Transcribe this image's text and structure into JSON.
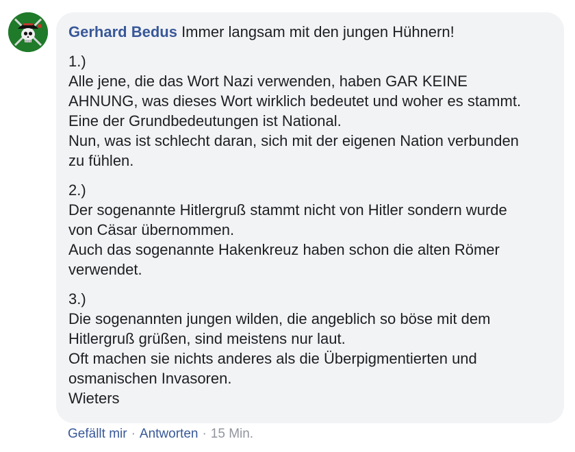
{
  "comment": {
    "author": "Gerhard Bedus",
    "intro": "Immer langsam mit den jungen Hühnern!",
    "paragraphs": [
      {
        "lines": [
          "1.)",
          "Alle jene, die das Wort Nazi verwenden, haben GAR KEINE",
          "AHNUNG, was dieses Wort wirklich bedeutet und woher es stammt.",
          "Eine der Grundbedeutungen ist National.",
          "Nun, was ist schlecht daran, sich mit der eigenen Nation verbunden",
          "zu fühlen."
        ]
      },
      {
        "lines": [
          "2.)",
          "Der sogenannte Hitlergruß stammt nicht von Hitler sondern wurde",
          "von Cäsar übernommen.",
          "Auch das sogenannte Hakenkreuz haben schon die alten Römer",
          "verwendet."
        ]
      },
      {
        "lines": [
          "3.)",
          "Die sogenannten jungen wilden, die angeblich so böse mit dem",
          "Hitlergruß grüßen, sind meistens nur laut.",
          "Oft machen sie nichts anderes als die Überpigmentierten und",
          "osmanischen Invasoren.",
          "Wieters"
        ]
      }
    ]
  },
  "actions": {
    "like": "Gefällt mir",
    "separator": "·",
    "reply": "Antworten",
    "time": "15 Min."
  },
  "avatar": {
    "icon": "skull-crossed-swords-icon",
    "background": "#1f7a2a"
  },
  "colors": {
    "author": "#385898",
    "bubble": "#f2f3f5",
    "text": "#1c1e21",
    "meta": "#90949c"
  }
}
